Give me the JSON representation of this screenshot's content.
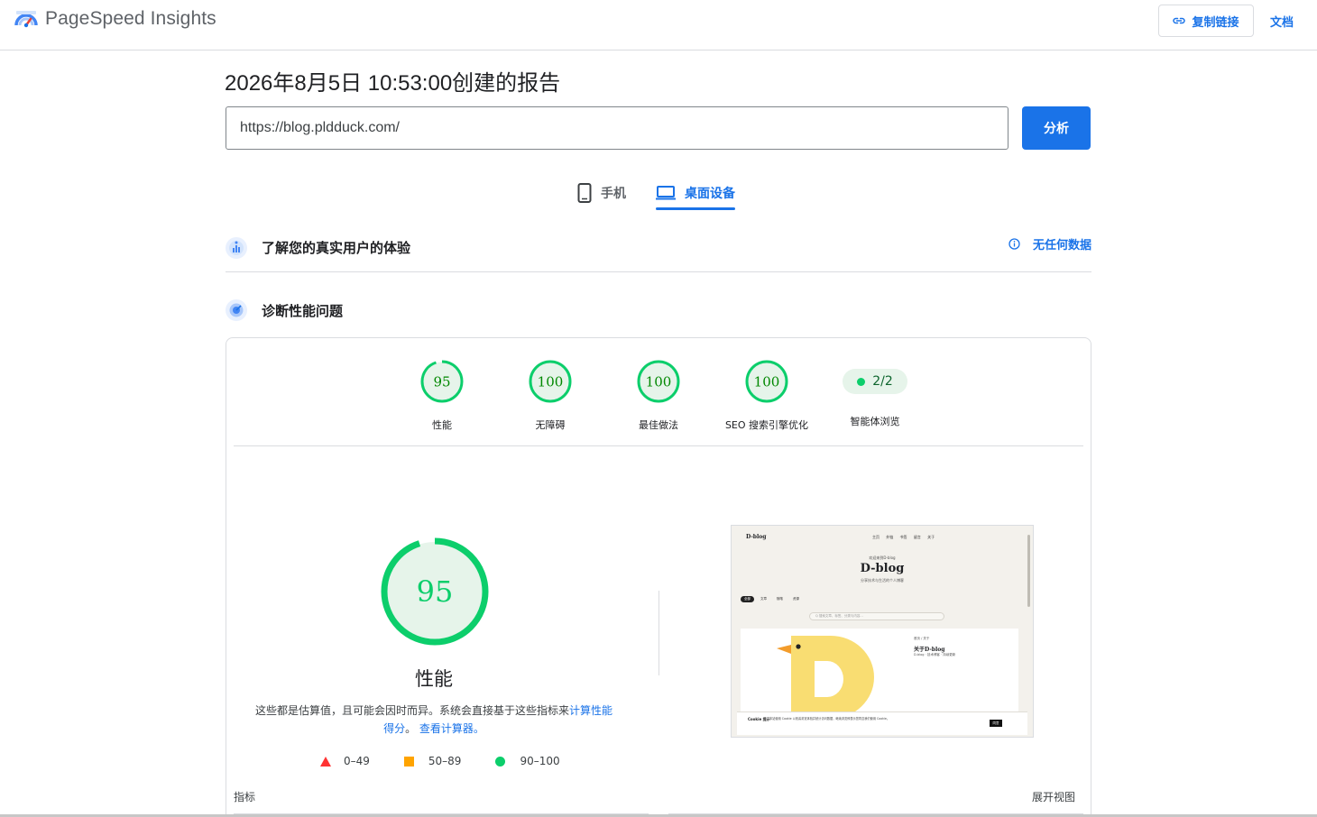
{
  "app": {
    "title": "PageSpeed Insights"
  },
  "header": {
    "copy_link_label": "复制链接",
    "docs_label": "文档"
  },
  "report": {
    "title": "2026年8月5日 10:53:00创建的报告"
  },
  "search": {
    "url_value": "https://blog.pldduck.com/",
    "analyze_label": "分析"
  },
  "device_tabs": [
    {
      "label": "手机",
      "icon": "phone-icon",
      "active": false
    },
    {
      "label": "桌面设备",
      "icon": "laptop-icon",
      "active": true
    }
  ],
  "sections": {
    "real_user": {
      "title": "了解您的真实用户的体验",
      "status": "无任何数据"
    },
    "diagnose": {
      "title": "诊断性能问题"
    }
  },
  "scores": [
    {
      "value": "95",
      "label": "性能",
      "score": 95,
      "color": "#0cce6b"
    },
    {
      "value": "100",
      "label": "无障碍",
      "score": 100,
      "color": "#0cce6b"
    },
    {
      "value": "100",
      "label": "最佳做法",
      "score": 100,
      "color": "#0cce6b"
    },
    {
      "value": "100",
      "label": "SEO  搜索引擎优化",
      "score": 100,
      "color": "#0cce6b"
    }
  ],
  "agent": {
    "value": "2/2",
    "label": "智能体浏览"
  },
  "performance": {
    "score": "95",
    "score_fraction": 0.95,
    "label": "性能",
    "note_prefix": "这些都是估算值，且可能会因时而异。系统会直接基于这些指标来",
    "note_link1": "计算性能得分",
    "note_mid": "。",
    "note_link2": "查看计算器。"
  },
  "legend": [
    {
      "range": "0–49",
      "shape": "triangle",
      "color": "#ff3333"
    },
    {
      "range": "50–89",
      "shape": "square",
      "color": "#ffa400"
    },
    {
      "range": "90–100",
      "shape": "circle",
      "color": "#0cce6b"
    }
  ],
  "thumbnail": {
    "brand": "D-blog",
    "menu": "主页 外链 书签 留言 关于",
    "tagline": "欢迎来到D-blog",
    "site_title": "D-blog",
    "subtitle": "分享技术与生活的个人博客",
    "chips": [
      "全部",
      "文章",
      "随笔",
      "资源"
    ],
    "search_placeholder": "Q 搜索文章、标签、分类与内容...",
    "crumb": "首页 / 关于",
    "about_title": "关于D-blog",
    "about_desc": "D-blog · 技术博客 · 持续更新",
    "cookie_title": "Cookie 提示",
    "cookie_desc": "本站使用 Cookie 以改善浏览体验并统计访问数据，继续浏览即表示您同意我们使用 Cookie。",
    "cookie_button": "同意"
  },
  "metrics": {
    "label": "指标",
    "expand_label": "展开视图"
  },
  "colors": {
    "accent": "#1a73e8",
    "pass": "#0cce6b",
    "pass_bg": "#e6f4ea"
  }
}
